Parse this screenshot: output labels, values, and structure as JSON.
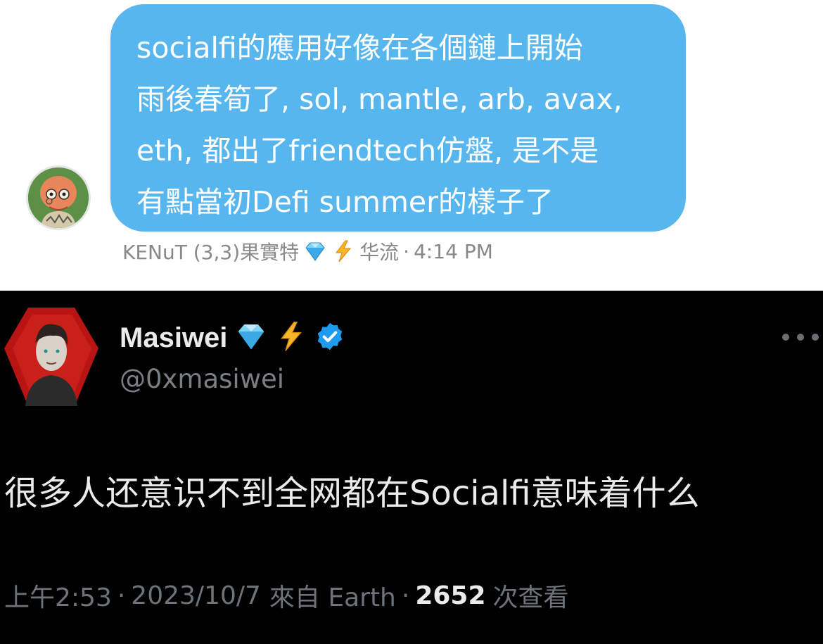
{
  "dm": {
    "message_lines": [
      "socialfi的應用好像在各個鏈上開始",
      "雨後春筍了, sol, mantle, arb, avax,",
      "eth, 都出了friendtech仿盤, 是不是",
      "有點當初Defi summer的樣子了"
    ],
    "sender_name": "KENuT (3,3)果實特",
    "sender_suffix": "华流",
    "separator": "·",
    "time": "4:14 PM",
    "bubble_color": "#58b6ef"
  },
  "tweet": {
    "author_name": "Masiwei",
    "author_handle": "@0xmasiwei",
    "text": "很多人还意识不到全网都在Socialfi意味着什么",
    "time": "上午2:53",
    "date": "2023/10/7",
    "source": "來自 Earth",
    "separator": "·",
    "views_count": "2652",
    "views_label": "次查看",
    "verified_color": "#1d9bf0"
  },
  "icons": {
    "gem": "gem-icon",
    "bolt": "lightning-icon",
    "verified": "verified-badge-icon",
    "more": "more-options-icon"
  }
}
